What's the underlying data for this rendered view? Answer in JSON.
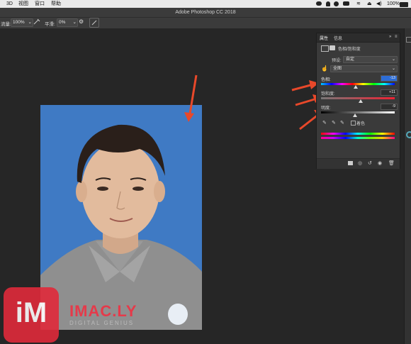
{
  "menubar": {
    "items": [
      "3D",
      "视图",
      "窗口",
      "帮助"
    ],
    "battery": "100%"
  },
  "app": {
    "title": "Adobe Photoshop CC 2018"
  },
  "options_bar": {
    "flow_label": "流量:",
    "flow_value": "100%",
    "smoothing_label": "平滑:",
    "smoothing_value": "0%"
  },
  "panel": {
    "tab_properties": "属性",
    "tab_info": "信息",
    "title": "色相/饱和度",
    "preset_label": "预设:",
    "preset_value": "自定",
    "channel_value": "全图",
    "hue_label": "色相:",
    "hue_value": "-13",
    "saturation_label": "饱和度:",
    "saturation_value": "+11",
    "lightness_label": "明度:",
    "lightness_value": "-9",
    "colorize_label": "着色",
    "hue_level": 0.47,
    "saturation_level": 0.54,
    "lightness_level": 0.46
  },
  "watermark": {
    "brand": "IMAC.LY",
    "tagline": "DIGITAL GENIUS",
    "icon_text": "iM"
  },
  "colors": {
    "accent": "#3e78c2",
    "arrow": "#e8482a",
    "logo": "#e02a3a"
  }
}
